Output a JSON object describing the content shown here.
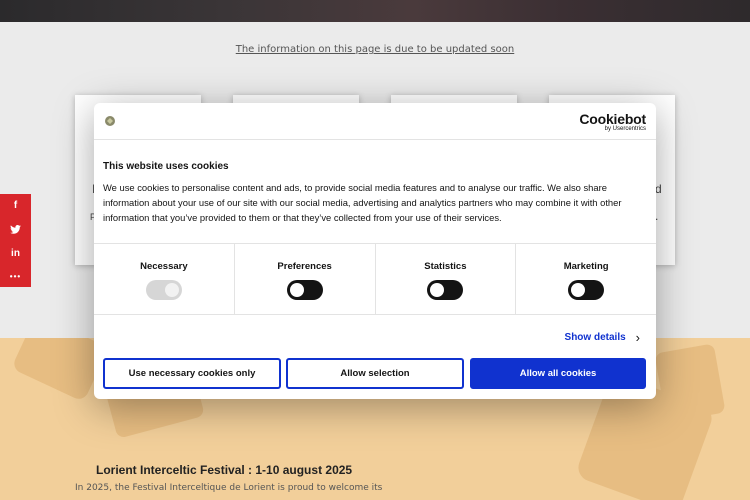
{
  "page": {
    "notice": "The information on this page is due to be updated soon",
    "card_fragments": [
      "I",
      "P",
      "d",
      "."
    ],
    "social": {
      "buttons": [
        {
          "icon": "facebook-icon",
          "glyph": "f"
        },
        {
          "icon": "twitter-icon",
          "glyph": "🐦"
        },
        {
          "icon": "linkedin-icon",
          "glyph": "in"
        },
        {
          "icon": "more-icon",
          "glyph": "•••"
        }
      ],
      "color": "#d8262b"
    },
    "festival": {
      "title": "Lorient Interceltic Festival : 1-10 august 2025",
      "text": "In 2025, the Festival Interceltique de Lorient is proud to welcome its"
    }
  },
  "cookie_dialog": {
    "brand_name": "Cookiebot",
    "brand_sub": "by Usercentrics",
    "title": "This website uses cookies",
    "body": "We use cookies to personalise content and ads, to provide social media features and to analyse our traffic. We also share information about your use of our site with our social media, advertising and analytics partners who may combine it with other information that you’ve provided to them or that they’ve collected from your use of their services.",
    "categories": [
      {
        "label": "Necessary",
        "enabled": true,
        "disabled": true
      },
      {
        "label": "Preferences",
        "enabled": false,
        "disabled": false
      },
      {
        "label": "Statistics",
        "enabled": false,
        "disabled": false
      },
      {
        "label": "Marketing",
        "enabled": false,
        "disabled": false
      }
    ],
    "show_details": "Show details",
    "buttons": {
      "necessary_only": "Use necessary cookies only",
      "allow_selection": "Allow selection",
      "allow_all": "Allow all cookies"
    },
    "accent_color": "#1032cf"
  }
}
